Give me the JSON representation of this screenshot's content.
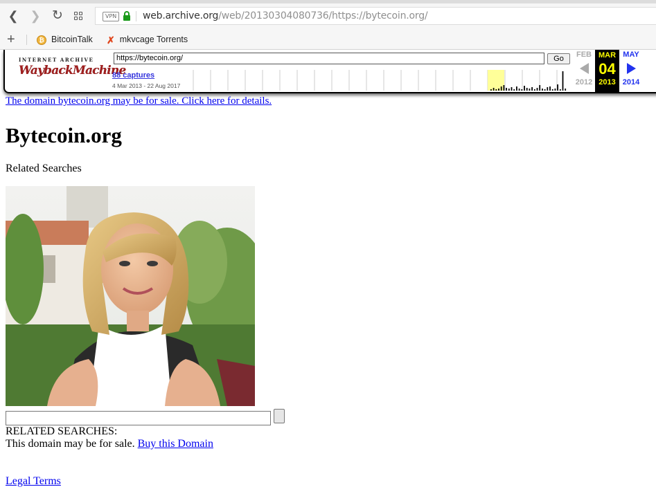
{
  "browser": {
    "url_host": "web.archive.org",
    "url_path": "/web/20130304080736/https://bytecoin.org/",
    "vpn_label": "VPN",
    "bookmarks": [
      {
        "label": "BitcoinTalk",
        "icon": "bitcoin-icon"
      },
      {
        "label": "mkvcage Torrents",
        "icon": "mkvcage-x-icon"
      }
    ]
  },
  "wayback": {
    "logo_top": "INTERNET ARCHIVE",
    "logo_main": "WaybackMachine",
    "url_value": "https://bytecoin.org/",
    "go_label": "Go",
    "captures": "88 captures",
    "range": "4 Mar 2013 - 22 Aug 2017",
    "prev": {
      "month": "FEB",
      "year": "2012"
    },
    "current": {
      "month": "MAR",
      "day": "04",
      "year": "2013"
    },
    "next": {
      "month": "MAY",
      "year": "2014"
    },
    "highlight_color": "#ffff99",
    "current_bg": "#000000",
    "current_fg": "#ffff00"
  },
  "page": {
    "sale_link": "The domain bytecoin.org may be for sale. Click here for details.",
    "title": "Bytecoin.org",
    "related_heading": "Related Searches",
    "search_value": "",
    "related_upper": "RELATED SEARCHES:",
    "sale_text": "This domain may be for sale.",
    "buy_link": "Buy this Domain",
    "legal_link": "Legal Terms"
  }
}
